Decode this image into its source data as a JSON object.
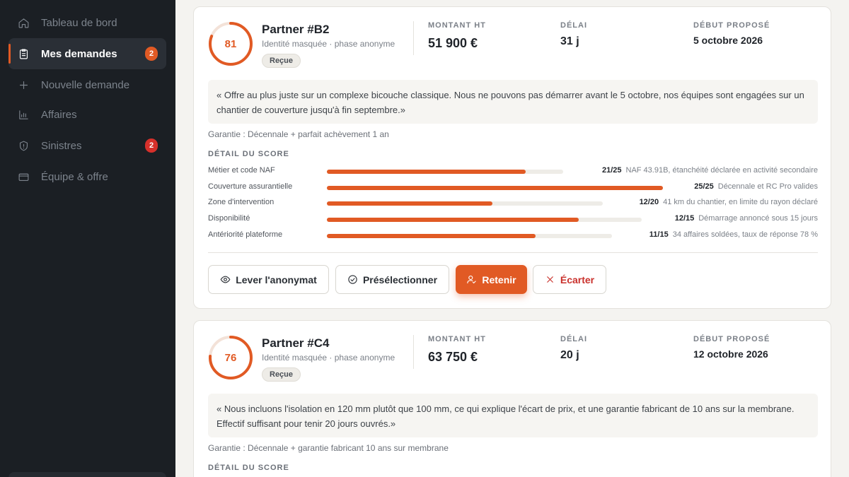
{
  "sidebar": {
    "items": [
      {
        "label": "Tableau de bord",
        "icon": "home-icon"
      },
      {
        "label": "Mes demandes",
        "icon": "clipboard-icon",
        "badge": "2",
        "active": true
      },
      {
        "label": "Nouvelle demande",
        "icon": "plus-icon"
      },
      {
        "label": "Affaires",
        "icon": "bar-chart-icon"
      },
      {
        "label": "Sinistres",
        "icon": "shield-icon",
        "badge": "2"
      },
      {
        "label": "Équipe & offre",
        "icon": "card-icon"
      }
    ]
  },
  "offers": [
    {
      "score": "81",
      "score_value": 81,
      "name": "Partner #B2",
      "subtitle": "Identité masquée · phase anonyme",
      "status": "Reçue",
      "amount_label": "MONTANT HT",
      "amount": "51 900 €",
      "delay_label": "DÉLAI",
      "delay": "31 j",
      "start_label": "DÉBUT PROPOSÉ",
      "start": "5 octobre 2026",
      "quote": "« Offre au plus juste sur un complexe bicouche classique. Nous ne pouvons pas démarrer avant le 5 octobre, nos équipes sont engagées sur un chantier de couverture jusqu'à fin septembre.»",
      "guarantee": "Garantie : Décennale + parfait achèvement 1 an",
      "score_title": "DÉTAIL DU SCORE",
      "criteria": [
        {
          "label": "Métier et code NAF",
          "score": "21/25",
          "ratio": 0.84,
          "note": "NAF 43.91B, étanchéité déclarée en activité secondaire"
        },
        {
          "label": "Couverture assurantielle",
          "score": "25/25",
          "ratio": 1.0,
          "note": "Décennale et RC Pro valides"
        },
        {
          "label": "Zone d'intervention",
          "score": "12/20",
          "ratio": 0.6,
          "note": "41 km du chantier, en limite du rayon déclaré"
        },
        {
          "label": "Disponibilité",
          "score": "12/15",
          "ratio": 0.8,
          "note": "Démarrage annoncé sous 15 jours"
        },
        {
          "label": "Antériorité plateforme",
          "score": "11/15",
          "ratio": 0.733,
          "note": "34 affaires soldées, taux de réponse 78 %"
        }
      ],
      "actions": {
        "reveal": "Lever l'anonymat",
        "shortlist": "Présélectionner",
        "retain": "Retenir",
        "reject": "Écarter"
      }
    },
    {
      "score": "76",
      "score_value": 76,
      "name": "Partner #C4",
      "subtitle": "Identité masquée · phase anonyme",
      "status": "Reçue",
      "amount_label": "MONTANT HT",
      "amount": "63 750 €",
      "delay_label": "DÉLAI",
      "delay": "20 j",
      "start_label": "DÉBUT PROPOSÉ",
      "start": "12 octobre 2026",
      "quote": "« Nous incluons l'isolation en 120 mm plutôt que 100 mm, ce qui explique l'écart de prix, et une garantie fabricant de 10 ans sur la membrane. Effectif suffisant pour tenir 20 jours ouvrés.»",
      "guarantee": "Garantie : Décennale + garantie fabricant 10 ans sur membrane",
      "score_title": "DÉTAIL DU SCORE"
    }
  ],
  "colors": {
    "accent": "#e15a24",
    "sidebar_bg": "#1b1f24",
    "danger": "#d7302b"
  }
}
